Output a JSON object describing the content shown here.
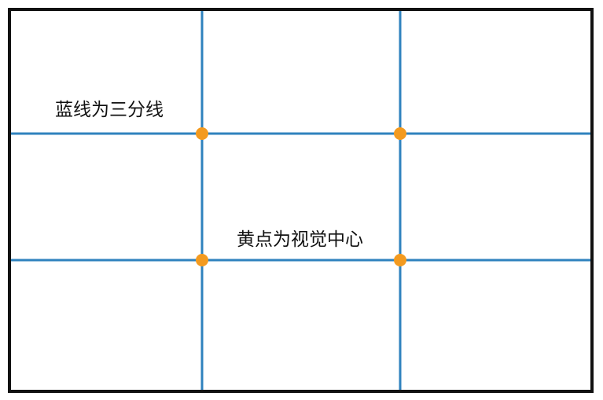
{
  "colors": {
    "frame": "#111111",
    "grid_line": "#2f82be",
    "dot": "#f39a1f"
  },
  "labels": {
    "blue_lines": "蓝线为三分线",
    "yellow_dots": "黄点为视觉中心"
  }
}
